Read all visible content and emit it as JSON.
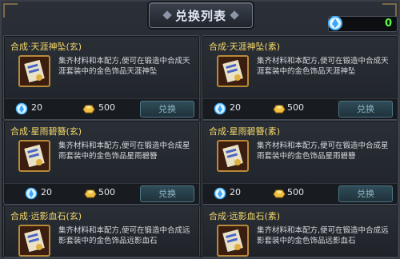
{
  "window": {
    "title": "兑换列表"
  },
  "currency": {
    "icon": "blue-gem-icon",
    "value": "0"
  },
  "cards": [
    {
      "name": "合成·天涯神坠(玄)",
      "desc": "集齐材料和本配方,便可在锻造中合成天涯套装中的金色饰品天涯神坠",
      "gem_cost": "20",
      "gold_cost": "500",
      "button": "兑换"
    },
    {
      "name": "合成·天涯神坠(素)",
      "desc": "集齐材料和本配方,便可在锻造中合成天涯套装中的金色饰品天涯神坠",
      "gem_cost": "20",
      "gold_cost": "500",
      "button": "兑换"
    },
    {
      "name": "合成·星雨碧簪(玄)",
      "desc": "集齐材料和本配方,便可在锻造中合成星雨套装中的金色饰品星雨碧簪",
      "gem_cost": "20",
      "gold_cost": "500",
      "button": "兑换"
    },
    {
      "name": "合成·星雨碧簪(素)",
      "desc": "集齐材料和本配方,便可在锻造中合成星雨套装中的金色饰品星雨碧簪",
      "gem_cost": "20",
      "gold_cost": "500",
      "button": "兑换"
    },
    {
      "name": "合成·远影血石(玄)",
      "desc": "集齐材料和本配方,便可在锻造中合成远影套装中的金色饰品远影血石"
    },
    {
      "name": "合成·远影血石(素)",
      "desc": "集齐材料和本配方,便可在锻造中合成远影套装中的金色饰品远影血石"
    }
  ],
  "colors": {
    "item_name": "#f5d86a",
    "currency_value": "#5cff3f",
    "button_text": "#8fb5c4"
  }
}
